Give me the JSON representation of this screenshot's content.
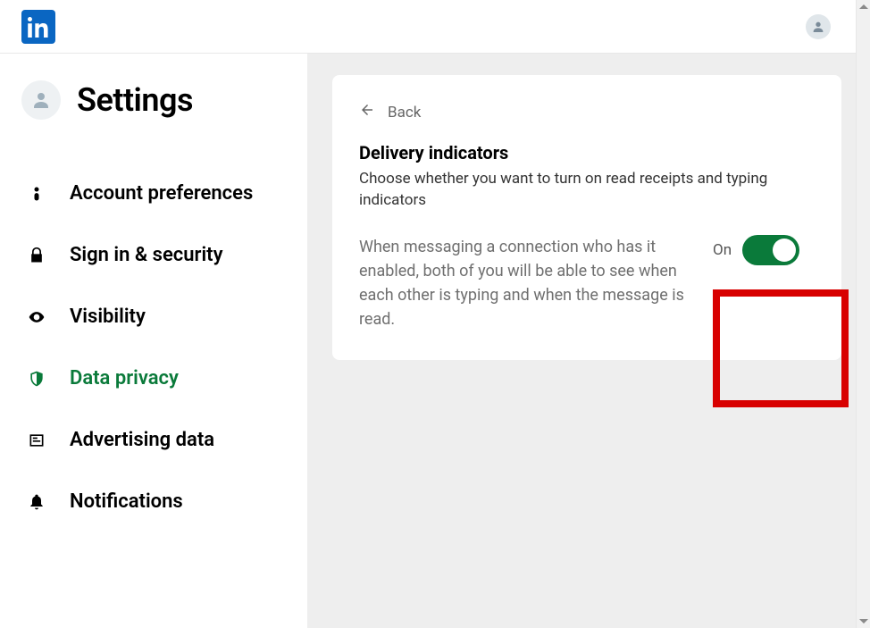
{
  "header": {
    "app": "LinkedIn"
  },
  "settings": {
    "title": "Settings",
    "nav": [
      {
        "key": "account",
        "label": "Account preferences",
        "icon": "person",
        "active": false
      },
      {
        "key": "security",
        "label": "Sign in & security",
        "icon": "lock",
        "active": false
      },
      {
        "key": "visibility",
        "label": "Visibility",
        "icon": "eye",
        "active": false
      },
      {
        "key": "privacy",
        "label": "Data privacy",
        "icon": "shield",
        "active": true
      },
      {
        "key": "ads",
        "label": "Advertising data",
        "icon": "newspaper",
        "active": false
      },
      {
        "key": "notif",
        "label": "Notifications",
        "icon": "bell",
        "active": false
      }
    ]
  },
  "card": {
    "back_label": "Back",
    "title": "Delivery indicators",
    "description": "Choose whether you want to turn on read receipts and typing indicators",
    "detail": "When messaging a connection who has it enabled, both of you will be able to see when each other is typing and when the message is read.",
    "toggle": {
      "state_label": "On",
      "value": true
    }
  },
  "colors": {
    "accent": "#0a7a3a",
    "brand": "#0a66c2",
    "highlight": "#d80000"
  }
}
